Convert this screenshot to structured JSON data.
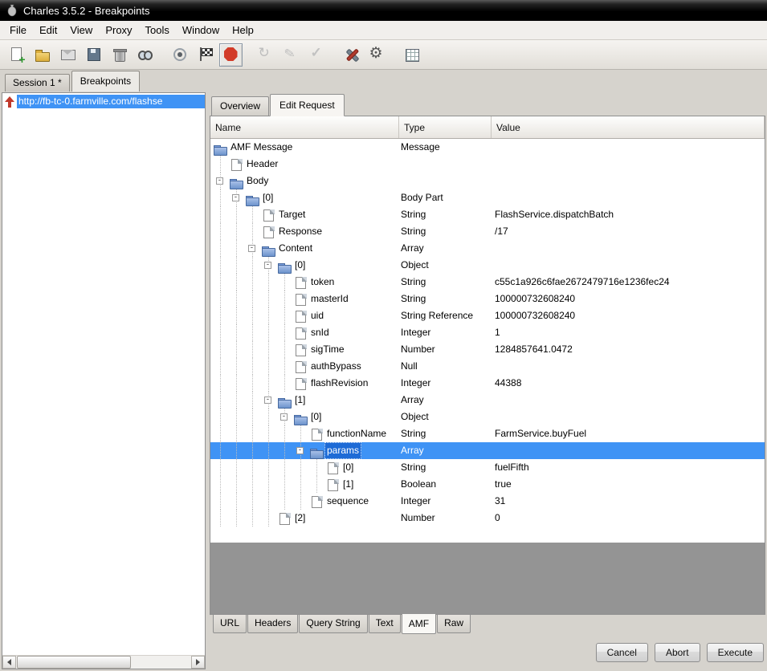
{
  "window": {
    "title": "Charles 3.5.2 - Breakpoints"
  },
  "menu": {
    "items": [
      "File",
      "Edit",
      "View",
      "Proxy",
      "Tools",
      "Window",
      "Help"
    ]
  },
  "toolbar": {
    "icons": [
      {
        "id": "new-session"
      },
      {
        "id": "open-session"
      },
      {
        "id": "export-session"
      },
      {
        "id": "save-session"
      },
      {
        "id": "trash"
      },
      {
        "id": "find"
      },
      {
        "id": "record",
        "group": true
      },
      {
        "id": "flag"
      },
      {
        "id": "breakpoints",
        "active": true
      },
      {
        "id": "repeat",
        "group": true
      },
      {
        "id": "edit"
      },
      {
        "id": "validate"
      },
      {
        "id": "tools",
        "group": true
      },
      {
        "id": "settings"
      },
      {
        "id": "compose",
        "group": true
      }
    ]
  },
  "session_tabs": [
    {
      "label": "Session 1 *",
      "active": false
    },
    {
      "label": "Breakpoints",
      "active": true
    }
  ],
  "sidebar": {
    "url": "http://fb-tc-0.farmville.com/flashse"
  },
  "request_tabs": [
    {
      "label": "Overview",
      "active": false
    },
    {
      "label": "Edit Request",
      "active": true
    }
  ],
  "table": {
    "columns": [
      "Name",
      "Type",
      "Value"
    ],
    "rows": [
      {
        "level": 0,
        "icon": "folder",
        "name": "AMF Message",
        "type": "Message",
        "value": ""
      },
      {
        "level": 1,
        "icon": "file",
        "name": "Header",
        "type": "",
        "value": ""
      },
      {
        "level": 1,
        "icon": "folder",
        "expander": true,
        "name": "Body",
        "type": "",
        "value": ""
      },
      {
        "level": 2,
        "icon": "folder",
        "expander": true,
        "name": "[0]",
        "type": "Body Part",
        "value": ""
      },
      {
        "level": 3,
        "icon": "file",
        "name": "Target",
        "type": "String",
        "value": "FlashService.dispatchBatch"
      },
      {
        "level": 3,
        "icon": "file",
        "name": "Response",
        "type": "String",
        "value": "/17"
      },
      {
        "level": 3,
        "icon": "folder",
        "expander": true,
        "name": "Content",
        "type": "Array",
        "value": ""
      },
      {
        "level": 4,
        "icon": "folder",
        "expander": true,
        "name": "[0]",
        "type": "Object",
        "value": ""
      },
      {
        "level": 5,
        "icon": "file",
        "name": "token",
        "type": "String",
        "value": "c55c1a926c6fae2672479716e1236fec24"
      },
      {
        "level": 5,
        "icon": "file",
        "name": "masterId",
        "type": "String",
        "value": "100000732608240"
      },
      {
        "level": 5,
        "icon": "file",
        "name": "uid",
        "type": "String Reference",
        "value": "100000732608240"
      },
      {
        "level": 5,
        "icon": "file",
        "name": "snId",
        "type": "Integer",
        "value": "1"
      },
      {
        "level": 5,
        "icon": "file",
        "name": "sigTime",
        "type": "Number",
        "value": "1284857641.0472"
      },
      {
        "level": 5,
        "icon": "file",
        "name": "authBypass",
        "type": "Null",
        "value": ""
      },
      {
        "level": 5,
        "icon": "file",
        "name": "flashRevision",
        "type": "Integer",
        "value": "44388"
      },
      {
        "level": 4,
        "icon": "folder",
        "expander": true,
        "name": "[1]",
        "type": "Array",
        "value": ""
      },
      {
        "level": 5,
        "icon": "folder",
        "expander": true,
        "name": "[0]",
        "type": "Object",
        "value": ""
      },
      {
        "level": 6,
        "icon": "file",
        "name": "functionName",
        "type": "String",
        "value": "FarmService.buyFuel"
      },
      {
        "level": 6,
        "icon": "folder",
        "expander": true,
        "name": "params",
        "type": "Array",
        "value": "",
        "selected": true
      },
      {
        "level": 7,
        "icon": "file",
        "name": "[0]",
        "type": "String",
        "value": "fuelFifth"
      },
      {
        "level": 7,
        "icon": "file",
        "name": "[1]",
        "type": "Boolean",
        "value": "true"
      },
      {
        "level": 6,
        "icon": "file",
        "name": "sequence",
        "type": "Integer",
        "value": "31"
      },
      {
        "level": 4,
        "icon": "file",
        "name": "[2]",
        "type": "Number",
        "value": "0"
      }
    ]
  },
  "bottom_tabs": [
    {
      "label": "URL",
      "active": false
    },
    {
      "label": "Headers",
      "active": false
    },
    {
      "label": "Query String",
      "active": false
    },
    {
      "label": "Text",
      "active": false
    },
    {
      "label": "AMF",
      "active": true
    },
    {
      "label": "Raw",
      "active": false
    }
  ],
  "actions": [
    {
      "id": "cancel",
      "label": "Cancel"
    },
    {
      "id": "abort",
      "label": "Abort"
    },
    {
      "id": "execute",
      "label": "Execute"
    }
  ],
  "colors": {
    "selection_blue": "#3f93f5",
    "selection_chip_blue": "#1e6bd6",
    "breakpoint_red": "#d23b28",
    "titlebar_bg": "#000000"
  }
}
